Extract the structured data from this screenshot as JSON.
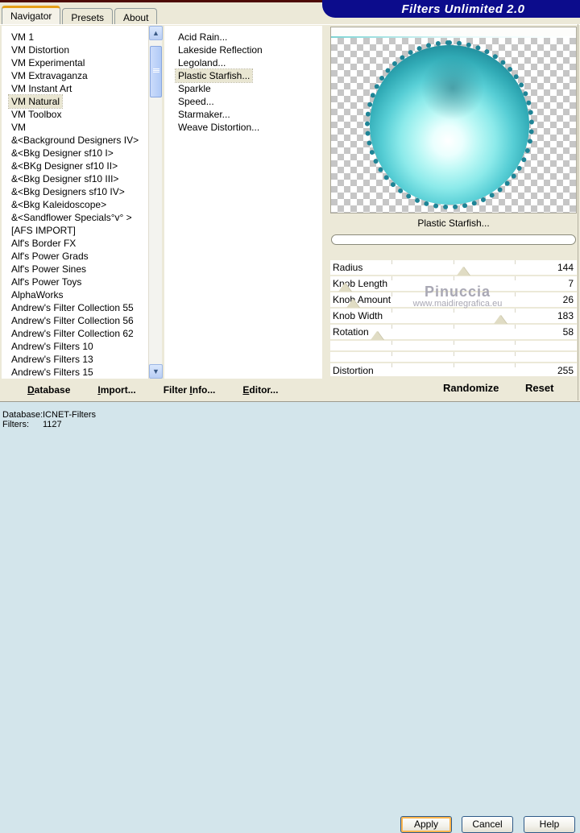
{
  "window": {
    "title": "Filters Unlimited 2.0"
  },
  "tabs": {
    "active_index": 0,
    "items": [
      {
        "label": "Navigator"
      },
      {
        "label": "Presets"
      },
      {
        "label": "About"
      }
    ]
  },
  "category_list": {
    "selected_index": 5,
    "items": [
      {
        "label": "VM 1"
      },
      {
        "label": "VM Distortion"
      },
      {
        "label": "VM Experimental"
      },
      {
        "label": "VM Extravaganza"
      },
      {
        "label": "VM Instant Art"
      },
      {
        "label": "VM Natural"
      },
      {
        "label": "VM Toolbox"
      },
      {
        "label": "VM"
      },
      {
        "label": "&<Background Designers IV>"
      },
      {
        "label": "&<Bkg Designer sf10 I>"
      },
      {
        "label": "&<BKg Designer sf10 II>"
      },
      {
        "label": "&<Bkg Designer sf10 III>"
      },
      {
        "label": "&<Bkg Designers sf10 IV>"
      },
      {
        "label": "&<Bkg Kaleidoscope>"
      },
      {
        "label": "&<Sandflower Specials°v° >"
      },
      {
        "label": "[AFS IMPORT]"
      },
      {
        "label": "Alf's Border FX"
      },
      {
        "label": "Alf's Power Grads"
      },
      {
        "label": "Alf's Power Sines"
      },
      {
        "label": "Alf's Power Toys"
      },
      {
        "label": "AlphaWorks"
      },
      {
        "label": "Andrew's Filter Collection 55"
      },
      {
        "label": "Andrew's Filter Collection 56"
      },
      {
        "label": "Andrew's Filter Collection 62"
      },
      {
        "label": "Andrew's Filters 10"
      },
      {
        "label": "Andrew's Filters 13"
      },
      {
        "label": "Andrew's Filters 15"
      }
    ]
  },
  "filter_list": {
    "selected_index": 3,
    "items": [
      {
        "label": "Acid Rain..."
      },
      {
        "label": "Lakeside Reflection"
      },
      {
        "label": "Legoland..."
      },
      {
        "label": "Plastic Starfish..."
      },
      {
        "label": "Sparkle"
      },
      {
        "label": "Speed..."
      },
      {
        "label": "Starmaker..."
      },
      {
        "label": "Weave Distortion..."
      }
    ]
  },
  "preview": {
    "caption": "Plastic Starfish...",
    "watermark_line1": "Pinuccia",
    "watermark_line2": "www.maidiregrafica.eu"
  },
  "sliders": [
    {
      "label": "Radius",
      "value": "144",
      "thumb_pct": 54,
      "h": 18
    },
    {
      "label": "Knob Length",
      "value": "7",
      "thumb_pct": 6,
      "h": 18
    },
    {
      "label": "Knob Amount",
      "value": "26",
      "thumb_pct": 9,
      "h": 18
    },
    {
      "label": "Knob Width",
      "value": "183",
      "thumb_pct": 69,
      "h": 18
    },
    {
      "label": "Rotation",
      "value": "58",
      "thumb_pct": 19,
      "h": 18
    },
    {
      "label": "",
      "value": "",
      "thumb_pct": null,
      "h": 12
    },
    {
      "label": "",
      "value": "",
      "thumb_pct": null,
      "h": 12
    },
    {
      "label": "Distortion",
      "value": "255",
      "thumb_pct": null,
      "h": 16
    }
  ],
  "actions": {
    "randomize": "Randomize",
    "reset": "Reset"
  },
  "menu": {
    "items": [
      {
        "pre": "",
        "u": "D",
        "post": "atabase"
      },
      {
        "pre": "",
        "u": "I",
        "post": "mport..."
      },
      {
        "pre": "Filter ",
        "u": "I",
        "post": "nfo..."
      },
      {
        "pre": "",
        "u": "E",
        "post": "ditor..."
      }
    ]
  },
  "status": {
    "database_label": "Database:",
    "database_value": "ICNET-Filters",
    "filters_label": "Filters:",
    "filters_value": "1127"
  },
  "buttons": {
    "apply": "Apply",
    "cancel": "Cancel",
    "help": "Help"
  },
  "colors": {
    "banner_navy": "#0c0c8c",
    "dialog_beige": "#ece9d8",
    "selection_beige": "#e9e6d2",
    "status_blue": "#d3e5eb",
    "sphere_teal": "#1e8496",
    "active_tab_orange": "#e5a01a",
    "top_line_maroon": "#4d0a05"
  }
}
